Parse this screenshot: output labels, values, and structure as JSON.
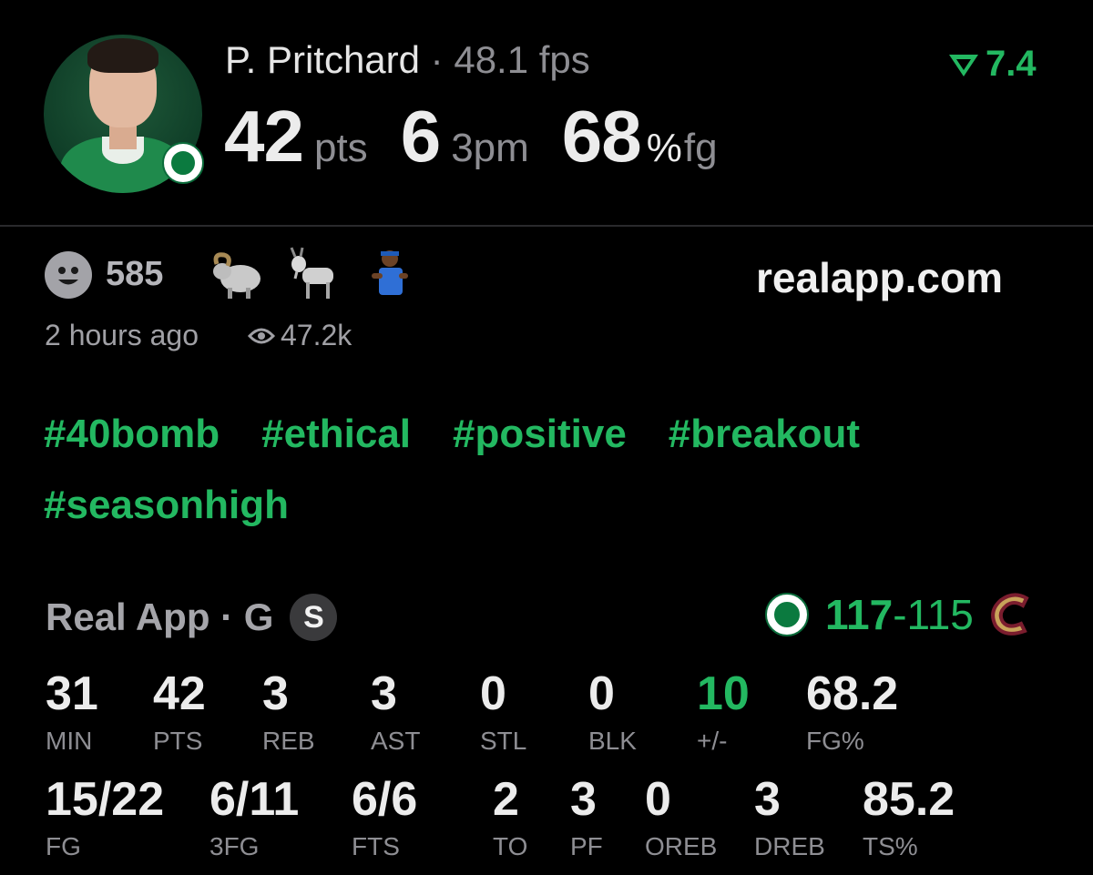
{
  "header": {
    "player_name": "P. Pritchard",
    "separator": "·",
    "fps": "48.1 fps",
    "rating": "7.4",
    "stats": [
      {
        "value": "42",
        "unit": "pts"
      },
      {
        "value": "6",
        "unit": "3pm"
      },
      {
        "value": "68",
        "pct": "%",
        "unit": "fg"
      }
    ]
  },
  "reactions": {
    "count": "585",
    "emojis": [
      "ram-emoji",
      "goat-emoji",
      "player-sticker"
    ],
    "site": "realapp.com",
    "time_ago": "2 hours ago",
    "views": "47.2k"
  },
  "hashtags": [
    "#40bomb",
    "#ethical",
    "#positive",
    "#breakout",
    "#seasonhigh"
  ],
  "game": {
    "source": "Real App · G",
    "badge": "S",
    "home_score": "117",
    "dash": "-",
    "away_score": "115"
  },
  "boxscore": {
    "row1": [
      {
        "value": "31",
        "label": "MIN"
      },
      {
        "value": "42",
        "label": "PTS"
      },
      {
        "value": "3",
        "label": "REB"
      },
      {
        "value": "3",
        "label": "AST"
      },
      {
        "value": "0",
        "label": "STL"
      },
      {
        "value": "0",
        "label": "BLK"
      },
      {
        "value": "10",
        "label": "+/-"
      },
      {
        "value": "68.2",
        "label": "FG%"
      }
    ],
    "row2": [
      {
        "value": "15/22",
        "label": "FG"
      },
      {
        "value": "6/11",
        "label": "3FG"
      },
      {
        "value": "6/6",
        "label": "FTS"
      },
      {
        "value": "2",
        "label": "TO"
      },
      {
        "value": "3",
        "label": "PF"
      },
      {
        "value": "0",
        "label": "OREB"
      },
      {
        "value": "3",
        "label": "DREB"
      },
      {
        "value": "85.2",
        "label": "TS%"
      }
    ]
  },
  "colors": {
    "accent_green": "#23b861",
    "background": "#000000",
    "muted": "#8e8e93"
  }
}
